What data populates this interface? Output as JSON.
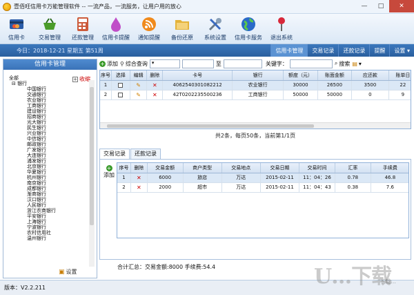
{
  "window": {
    "title": "壹佰旺信用卡万能管理软件 -- 一流产品，一流服务，让用户用的放心"
  },
  "toolbar": [
    {
      "label": "信用卡",
      "icon": "credit-card-icon"
    },
    {
      "label": "交易管理",
      "icon": "basket-icon"
    },
    {
      "label": "还款管理",
      "icon": "calculator-icon"
    },
    {
      "label": "信用卡提醒",
      "icon": "drop-icon"
    },
    {
      "label": "通知提醒",
      "icon": "rss-icon"
    },
    {
      "label": "备份还原",
      "icon": "folder-icon"
    },
    {
      "label": "系统设置",
      "icon": "tools-icon"
    },
    {
      "label": "信用卡服务",
      "icon": "globe-icon"
    },
    {
      "label": "退出系统",
      "icon": "pin-icon"
    }
  ],
  "infobar": {
    "date": "今日：2018-12-21 星期五 第51周",
    "menus": [
      "信用卡管理",
      "交易记录",
      "还款记录",
      "提醒",
      "设置 ▾"
    ]
  },
  "left": {
    "header": "信用卡管理",
    "collapse": "收缩",
    "tree": [
      "全部",
      "银行",
      "中国银行",
      "交通银行",
      "农业银行",
      "工商银行",
      "建设银行",
      "招商银行",
      "光大银行",
      "民生银行",
      "兴业银行",
      "中信银行",
      "邮政银行",
      "广发银行",
      "大连银行",
      "浦发银行",
      "北京银行",
      "华夏银行",
      "杭州银行",
      "南京银行",
      "成都银行",
      "渐商银行",
      "汉口银行",
      "人民银行",
      "浙江农商银行",
      "平安银行",
      "上海银行",
      "宁波银行",
      "农村信用社",
      "温州银行"
    ],
    "settings": "设置"
  },
  "search": {
    "add": "添加",
    "query": "综合查询",
    "to": "至",
    "keyword": "关键字：",
    "search_btn": "搜索"
  },
  "cards": {
    "columns": [
      "序号",
      "选择",
      "编辑",
      "删除",
      "卡号",
      "银行",
      "额度（元）",
      "账面金额",
      "应还款",
      "账单日"
    ],
    "rows": [
      {
        "no": "1",
        "card": "4062540301082212",
        "bank": "农业银行",
        "limit": "30000",
        "balance": "26500",
        "due": "3500",
        "bill": "22"
      },
      {
        "no": "2",
        "card": "42T0202235500236",
        "bank": "工商银行",
        "limit": "50000",
        "balance": "50000",
        "due": "0",
        "bill": "9"
      }
    ]
  },
  "pager": "共2条，每页50条，当前第1/1页",
  "tabs": [
    "交易记录",
    "还款记录"
  ],
  "add_label": "添加",
  "tx": {
    "columns": [
      "序号",
      "删除",
      "交易金额",
      "商户类型",
      "交易地点",
      "交易日期",
      "交易时间",
      "汇率",
      "手续费"
    ],
    "rows": [
      {
        "no": "1",
        "amount": "6000",
        "type": "旅店",
        "place": "万达",
        "date": "2015-02-11",
        "time": "11：04：26",
        "rate": "0.78",
        "fee": "46.8"
      },
      {
        "no": "2",
        "amount": "2000",
        "type": "超市",
        "place": "万达",
        "date": "2015-02-11",
        "time": "11：04：43",
        "rate": "0.38",
        "fee": "7.6"
      }
    ]
  },
  "summary": "合计汇总：交易金额:8000  手续费:54.4",
  "version": "版本：V2.2.211",
  "watermark": "U…下载",
  "watermark2": "下载…"
}
